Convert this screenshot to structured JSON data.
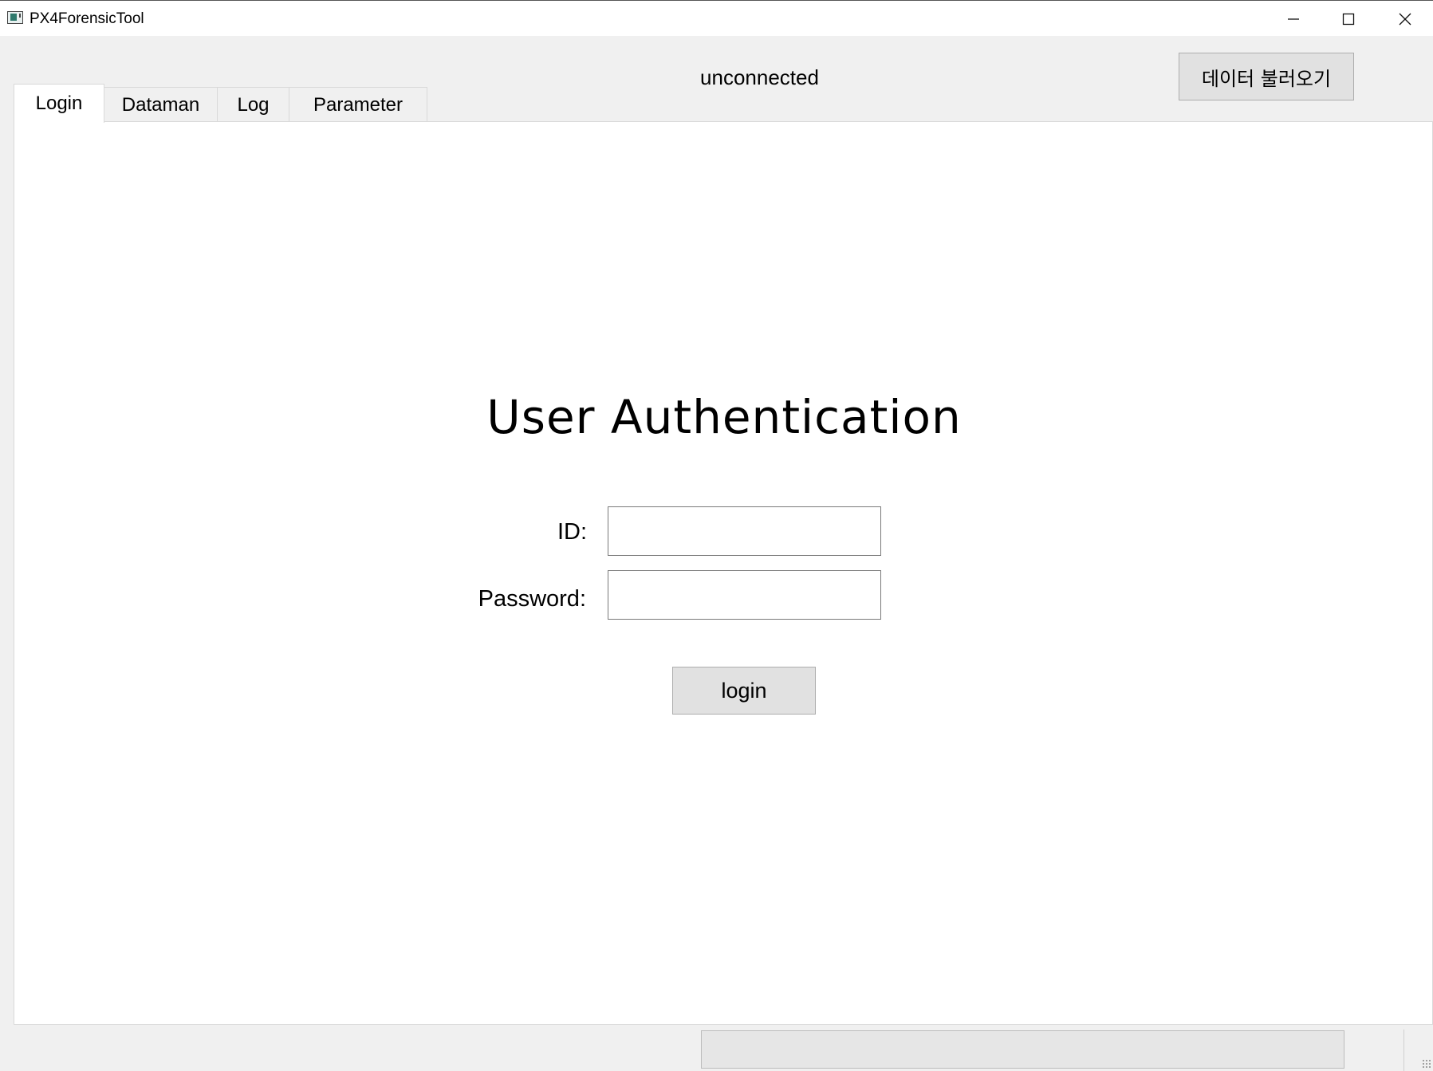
{
  "window": {
    "title": "PX4ForensicTool",
    "icon": "app-window-icon"
  },
  "header": {
    "connection_status": "unconnected",
    "load_data_label": "데이터 불러오기"
  },
  "tabs": [
    {
      "label": "Login",
      "active": true
    },
    {
      "label": "Dataman",
      "active": false
    },
    {
      "label": "Log",
      "active": false
    },
    {
      "label": "Parameter",
      "active": false
    }
  ],
  "login": {
    "title": "User Authentication",
    "id_label": "ID:",
    "id_value": "",
    "password_label": "Password:",
    "password_value": "",
    "login_button": "login"
  },
  "statusbar": {
    "progress_percent": 0
  },
  "colors": {
    "background": "#f0f0f0",
    "panel": "#ffffff",
    "button": "#e1e1e1"
  }
}
